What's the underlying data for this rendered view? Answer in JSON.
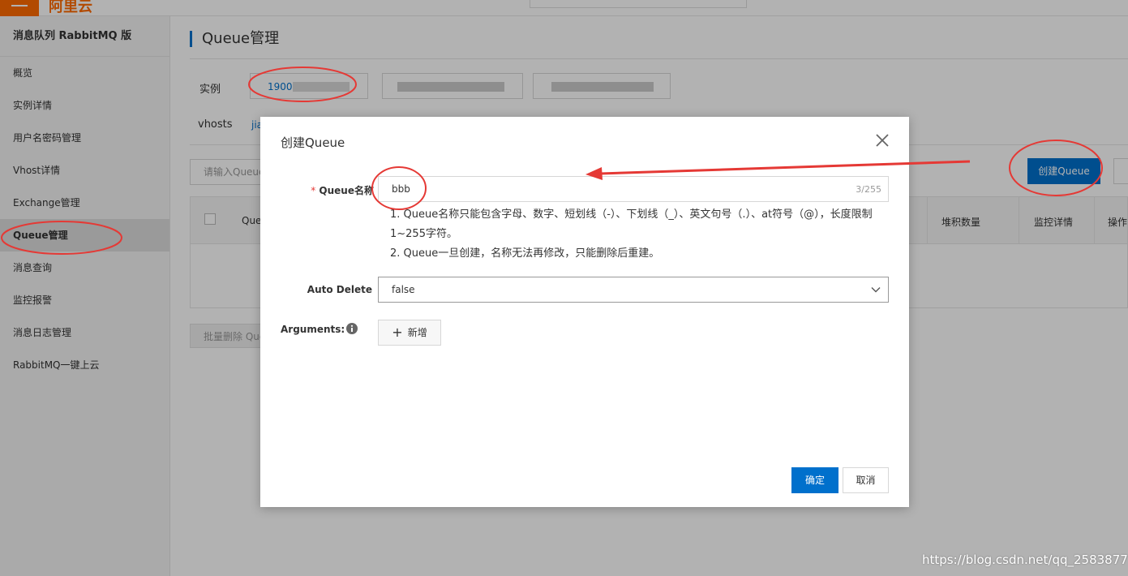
{
  "topbar": {
    "logo": "阿里云"
  },
  "sidebar": {
    "title": "消息队列 RabbitMQ 版",
    "items": [
      {
        "label": "概览"
      },
      {
        "label": "实例详情"
      },
      {
        "label": "用户名密码管理"
      },
      {
        "label": "Vhost详情"
      },
      {
        "label": "Exchange管理"
      },
      {
        "label": "Queue管理"
      },
      {
        "label": "消息查询"
      },
      {
        "label": "监控报警"
      },
      {
        "label": "消息日志管理"
      },
      {
        "label": "RabbitMQ一键上云"
      }
    ]
  },
  "main": {
    "title": "Queue管理",
    "instance_label": "实例",
    "instance_value": "1900",
    "vhosts_label": "vhosts",
    "vhost_value": "jia",
    "filter_placeholder": "请输入Queue",
    "create_button": "创建Queue",
    "table_headers": [
      "Queu",
      "堆积数量",
      "监控详情",
      "操作"
    ],
    "batch_delete": "批量删除 Que"
  },
  "dialog": {
    "title": "创建Queue",
    "name_label": "Queue名称",
    "required_mark": "*",
    "name_value": "bbb",
    "name_count": "3/255",
    "hint_line1": "1. Queue名称只能包含字母、数字、短划线（-）、下划线（_）、英文句号（.）、at符号（@），长度限制1~255字符。",
    "hint_line2": "2. Queue一旦创建，名称无法再修改，只能删除后重建。",
    "auto_delete_label": "Auto Delete",
    "auto_delete_value": "false",
    "arguments_label": "Arguments:",
    "add_button": "新增",
    "ok_button": "确定",
    "cancel_button": "取消"
  },
  "watermark": "https://blog.csdn.net/qq_25838777",
  "colors": {
    "primary": "#0070cc",
    "brand": "#ff6a00",
    "annotation": "#e53935"
  }
}
